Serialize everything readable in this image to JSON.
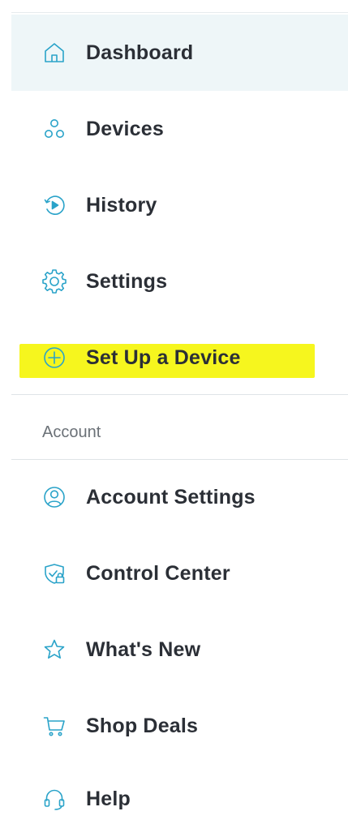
{
  "accent_color": "#2aa3c9",
  "highlight_color": "#f6f61e",
  "nav": {
    "items": [
      {
        "label": "Dashboard",
        "icon": "house-icon"
      },
      {
        "label": "Devices",
        "icon": "devices-icon"
      },
      {
        "label": "History",
        "icon": "history-icon"
      },
      {
        "label": "Settings",
        "icon": "gear-icon"
      },
      {
        "label": "Set Up a Device",
        "icon": "plus-circle-icon"
      }
    ]
  },
  "account": {
    "section_label": "Account",
    "items": [
      {
        "label": "Account Settings",
        "icon": "user-circle-icon"
      },
      {
        "label": "Control Center",
        "icon": "shield-lock-icon"
      },
      {
        "label": "What's New",
        "icon": "star-icon"
      },
      {
        "label": "Shop Deals",
        "icon": "cart-icon"
      },
      {
        "label": "Help",
        "icon": "headset-icon"
      }
    ]
  }
}
